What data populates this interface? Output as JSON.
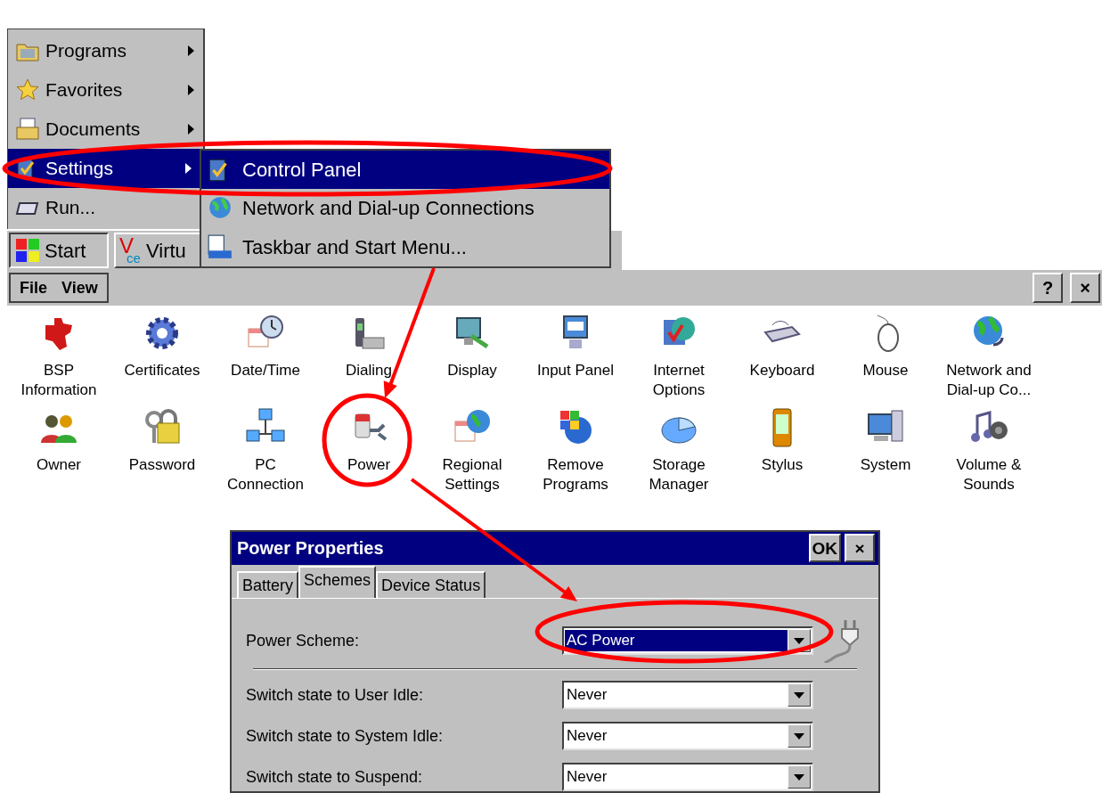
{
  "start_menu": {
    "items": [
      {
        "label": "Programs",
        "submenu": true,
        "selected": false
      },
      {
        "label": "Favorites",
        "submenu": true,
        "selected": false
      },
      {
        "label": "Documents",
        "submenu": true,
        "selected": false
      },
      {
        "label": "Settings",
        "submenu": true,
        "selected": true
      },
      {
        "label": "Run...",
        "submenu": false,
        "selected": false
      }
    ],
    "submenu": [
      {
        "label": "Control Panel",
        "selected": true
      },
      {
        "label": "Network and Dial-up Connections",
        "selected": false
      },
      {
        "label": "Taskbar and Start Menu...",
        "selected": false
      }
    ]
  },
  "taskbar": {
    "start": "Start",
    "app_logo": {
      "main": "V",
      "sub": "ce"
    },
    "app_label": "Virtu"
  },
  "control_panel": {
    "menu": [
      "File",
      "View"
    ],
    "title_buttons": [
      "?",
      "×"
    ],
    "items": [
      {
        "label": "BSP\nInformation"
      },
      {
        "label": "Certificates"
      },
      {
        "label": "Date/Time"
      },
      {
        "label": "Dialing"
      },
      {
        "label": "Display"
      },
      {
        "label": "Input Panel"
      },
      {
        "label": "Internet\nOptions"
      },
      {
        "label": "Keyboard"
      },
      {
        "label": "Mouse"
      },
      {
        "label": "Network and\nDial-up Co..."
      },
      {
        "label": "Owner"
      },
      {
        "label": "Password"
      },
      {
        "label": "PC\nConnection"
      },
      {
        "label": "Power"
      },
      {
        "label": "Regional\nSettings"
      },
      {
        "label": "Remove\nPrograms"
      },
      {
        "label": "Storage\nManager"
      },
      {
        "label": "Stylus"
      },
      {
        "label": "System"
      },
      {
        "label": "Volume &\nSounds"
      }
    ]
  },
  "dialog": {
    "title": "Power Properties",
    "buttons": [
      "OK",
      "×"
    ],
    "tabs": [
      {
        "label": "Battery",
        "selected": false
      },
      {
        "label": "Schemes",
        "selected": true
      },
      {
        "label": "Device Status",
        "selected": false
      }
    ],
    "scheme": {
      "label": "Power Scheme:",
      "value": "AC Power",
      "selected": true
    },
    "rows": [
      {
        "label": "Switch state to User Idle:",
        "value": "Never"
      },
      {
        "label": "Switch state to System Idle:",
        "value": "Never"
      },
      {
        "label": "Switch state to Suspend:",
        "value": "Never"
      }
    ]
  }
}
